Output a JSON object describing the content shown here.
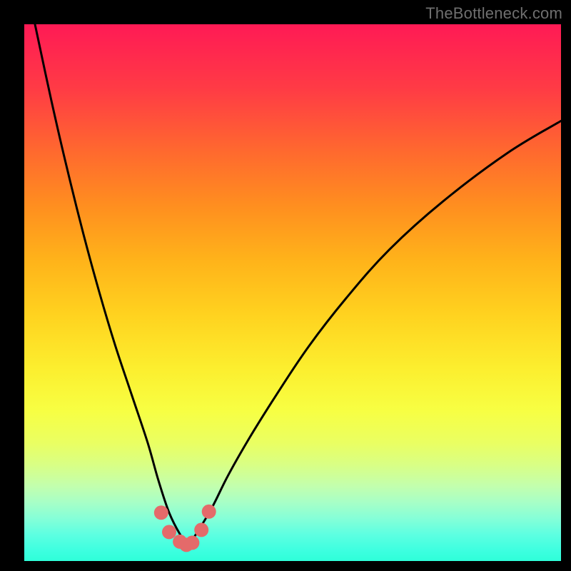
{
  "watermark": "TheBottleneck.com",
  "chart_data": {
    "type": "line",
    "title": "",
    "xlabel": "",
    "ylabel": "",
    "xlim": [
      0,
      100
    ],
    "ylim": [
      0,
      100
    ],
    "grid": false,
    "series": [
      {
        "name": "bottleneck-curve",
        "x": [
          2,
          5,
          8,
          11,
          14,
          17,
          20,
          23,
          25,
          27,
          29,
          30.5,
          32,
          35,
          38,
          42,
          47,
          53,
          60,
          68,
          78,
          90,
          100
        ],
        "values": [
          100,
          86,
          73,
          61,
          50,
          40,
          31,
          22,
          15,
          9,
          5,
          3,
          5,
          10,
          16,
          23,
          31,
          40,
          49,
          58,
          67,
          76,
          82
        ]
      }
    ],
    "markers": [
      {
        "x": 25.5,
        "y": 9
      },
      {
        "x": 27.0,
        "y": 5.4
      },
      {
        "x": 29.0,
        "y": 3.6
      },
      {
        "x": 30.2,
        "y": 3.0
      },
      {
        "x": 31.3,
        "y": 3.4
      },
      {
        "x": 33.0,
        "y": 5.8
      },
      {
        "x": 34.4,
        "y": 9.2
      }
    ],
    "gradient_stops": [
      {
        "pct": 0,
        "color": "#ff1a55"
      },
      {
        "pct": 24,
        "color": "#ff6a2e"
      },
      {
        "pct": 54,
        "color": "#ffd21f"
      },
      {
        "pct": 78,
        "color": "#eaff62"
      },
      {
        "pct": 100,
        "color": "#2fffd9"
      }
    ],
    "marker_color": "#e46a6a",
    "curve_color": "#000000"
  }
}
